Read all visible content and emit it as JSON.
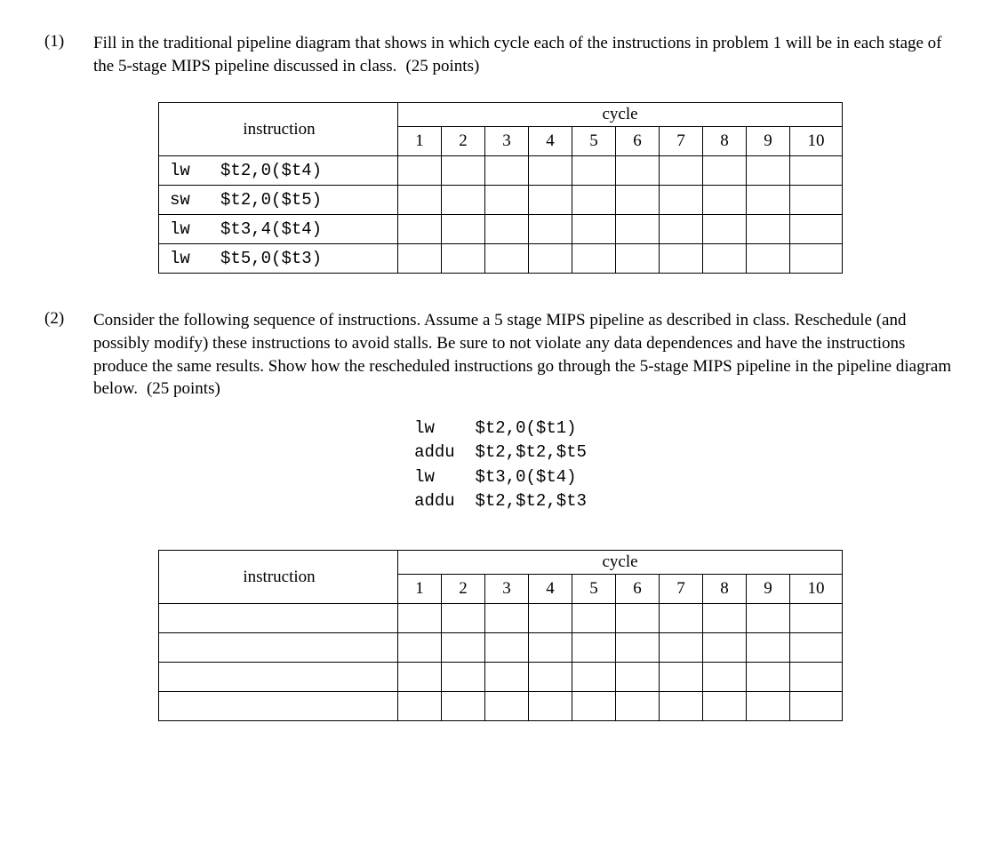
{
  "problems": [
    {
      "number": "(1)",
      "prompt": "Fill in the traditional pipeline diagram that shows in which cycle each of the instructions in problem 1 will be in each stage of the 5-stage MIPS pipeline discussed in class.",
      "points": "(25 points)"
    },
    {
      "number": "(2)",
      "prompt": "Consider the following sequence of instructions.  Assume a 5 stage MIPS pipeline as described in class.  Reschedule (and possibly modify) these instructions to avoid stalls.  Be sure to not violate any data dependences and have the instructions produce the same results.  Show how the rescheduled instructions go through the 5-stage MIPS pipeline in the pipeline diagram below.",
      "points": "(25 points)"
    }
  ],
  "tableHeaders": {
    "instruction": "instruction",
    "cycle": "cycle"
  },
  "cycleNumbers": [
    "1",
    "2",
    "3",
    "4",
    "5",
    "6",
    "7",
    "8",
    "9",
    "10"
  ],
  "table1Instructions": [
    {
      "op": "lw",
      "args": "$t2,0($t4)"
    },
    {
      "op": "sw",
      "args": "$t2,0($t5)"
    },
    {
      "op": "lw",
      "args": "$t3,4($t4)"
    },
    {
      "op": "lw",
      "args": "$t5,0($t3)"
    }
  ],
  "codeBlock": [
    {
      "op": "lw",
      "args": "$t2,0($t1)"
    },
    {
      "op": "addu",
      "args": "$t2,$t2,$t5"
    },
    {
      "op": "lw",
      "args": "$t3,0($t4)"
    },
    {
      "op": "addu",
      "args": "$t2,$t2,$t3"
    }
  ],
  "chart_data": [
    {
      "type": "table",
      "title": "Problem 1 pipeline diagram (blank)",
      "row_header": "instruction",
      "col_group_header": "cycle",
      "columns": [
        "1",
        "2",
        "3",
        "4",
        "5",
        "6",
        "7",
        "8",
        "9",
        "10"
      ],
      "rows": [
        {
          "instruction": "lw   $t2,0($t4)",
          "cells": [
            "",
            "",
            "",
            "",
            "",
            "",
            "",
            "",
            "",
            ""
          ]
        },
        {
          "instruction": "sw   $t2,0($t5)",
          "cells": [
            "",
            "",
            "",
            "",
            "",
            "",
            "",
            "",
            "",
            ""
          ]
        },
        {
          "instruction": "lw   $t3,4($t4)",
          "cells": [
            "",
            "",
            "",
            "",
            "",
            "",
            "",
            "",
            "",
            ""
          ]
        },
        {
          "instruction": "lw   $t5,0($t3)",
          "cells": [
            "",
            "",
            "",
            "",
            "",
            "",
            "",
            "",
            "",
            ""
          ]
        }
      ]
    },
    {
      "type": "table",
      "title": "Problem 2 pipeline diagram (blank)",
      "row_header": "instruction",
      "col_group_header": "cycle",
      "columns": [
        "1",
        "2",
        "3",
        "4",
        "5",
        "6",
        "7",
        "8",
        "9",
        "10"
      ],
      "rows": [
        {
          "instruction": "",
          "cells": [
            "",
            "",
            "",
            "",
            "",
            "",
            "",
            "",
            "",
            ""
          ]
        },
        {
          "instruction": "",
          "cells": [
            "",
            "",
            "",
            "",
            "",
            "",
            "",
            "",
            "",
            ""
          ]
        },
        {
          "instruction": "",
          "cells": [
            "",
            "",
            "",
            "",
            "",
            "",
            "",
            "",
            "",
            ""
          ]
        },
        {
          "instruction": "",
          "cells": [
            "",
            "",
            "",
            "",
            "",
            "",
            "",
            "",
            "",
            ""
          ]
        }
      ]
    }
  ]
}
